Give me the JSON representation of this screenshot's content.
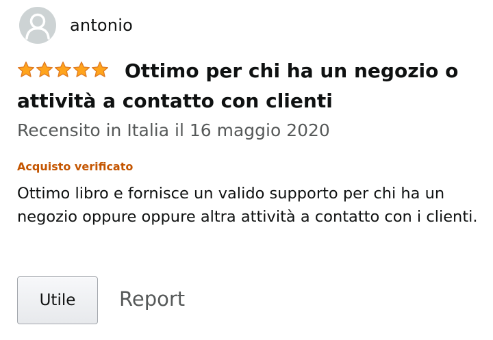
{
  "reviewer": {
    "name": "antonio",
    "avatar_icon": "person-silhouette-icon"
  },
  "review": {
    "rating": 5,
    "rating_max": 5,
    "star_color": "#ffa41c",
    "title": "Ottimo per chi ha un negozio o attività a contatto con clienti",
    "date_text": "Recensito in Italia il 16 maggio 2020",
    "verified_label": "Acquisto verificato",
    "verified_color": "#c45500",
    "body": "Ottimo libro e fornisce un valido supporto per chi ha un negozio oppure oppure altra attività a contatto con i clienti."
  },
  "actions": {
    "helpful_label": "Utile",
    "report_label": "Report"
  }
}
